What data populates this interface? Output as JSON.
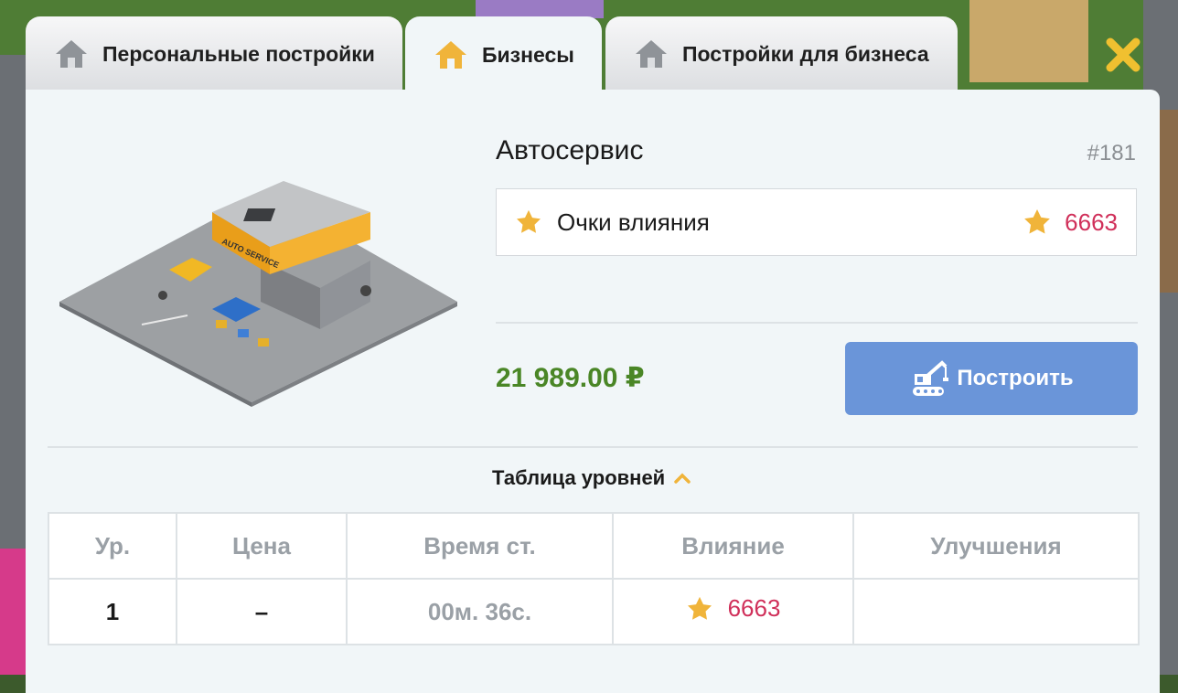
{
  "tabs": [
    {
      "label": "Персональные постройки",
      "active": false
    },
    {
      "label": "Бизнесы",
      "active": true
    },
    {
      "label": "Постройки для бизнеса",
      "active": false
    }
  ],
  "business": {
    "name": "Автосервис",
    "id": "#181",
    "building_sign": "AUTO SERVICE",
    "influence_label": "Очки влияния",
    "influence_value": "6663",
    "price": "21 989.00 ₽",
    "build_label": "Построить"
  },
  "levels_table": {
    "toggle_label": "Таблица уровней",
    "headers": [
      "Ур.",
      "Цена",
      "Время ст.",
      "Влияние",
      "Улучшения"
    ],
    "rows": [
      {
        "level": "1",
        "price": "–",
        "time": "00м. 36с.",
        "influence": "6663",
        "upgrades": ""
      }
    ]
  },
  "colors": {
    "accent_orange": "#f0b43a",
    "influence_red": "#d0305a",
    "price_green": "#4a8626",
    "build_blue": "#6a95d9"
  },
  "icons": {
    "tab": "house-icon",
    "star": "star-icon",
    "build": "crane-icon",
    "close": "close-icon",
    "toggle": "chevron-up-icon"
  }
}
